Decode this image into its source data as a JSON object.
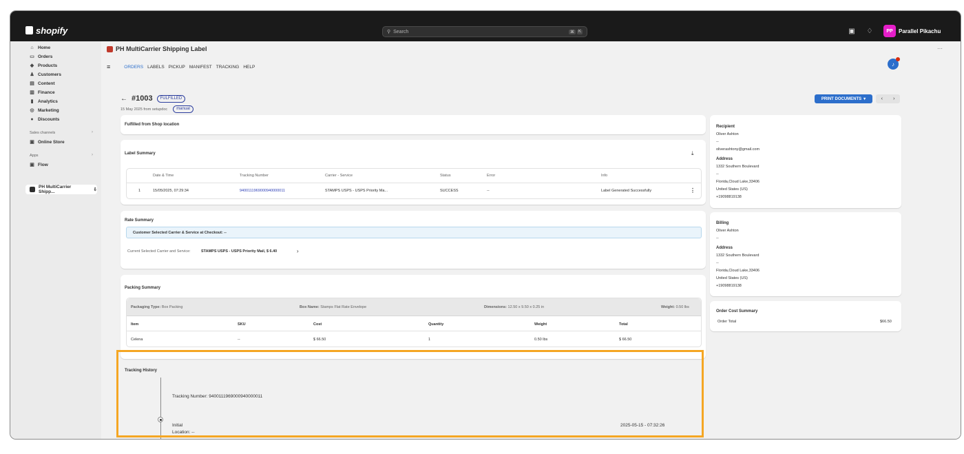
{
  "topbar": {
    "brand": "shopify",
    "search_placeholder": "Search",
    "search_kbd": [
      "⌘",
      "K"
    ],
    "avatar_initials": "PP",
    "user_name": "Parallel Pikachu"
  },
  "sidebar": {
    "items": [
      {
        "label": "Home",
        "icon": "home-icon"
      },
      {
        "label": "Orders",
        "icon": "inbox-icon"
      },
      {
        "label": "Products",
        "icon": "tag-icon"
      },
      {
        "label": "Customers",
        "icon": "person-icon"
      },
      {
        "label": "Content",
        "icon": "image-icon"
      },
      {
        "label": "Finance",
        "icon": "bank-icon"
      },
      {
        "label": "Analytics",
        "icon": "bar-chart-icon"
      },
      {
        "label": "Marketing",
        "icon": "target-icon"
      },
      {
        "label": "Discounts",
        "icon": "discount-icon"
      }
    ],
    "sales_channels_label": "Sales channels",
    "online_store_label": "Online Store",
    "apps_label": "Apps",
    "flow_label": "Flow",
    "active_app_label": "PH MultiCarrier Shipp..."
  },
  "app": {
    "title": "PH MultiCarrier Shipping Label",
    "nav_tabs": [
      "ORDERS",
      "LABELS",
      "PICKUP",
      "MANIFEST",
      "TRACKING",
      "HELP"
    ],
    "active_tab": "ORDERS"
  },
  "order": {
    "number": "#1003",
    "status_badge": "FULFILLED",
    "subtitle": "15 May 2025 from setupdoc",
    "tag": "manual",
    "print_label": "PRINT DOCUMENTS"
  },
  "fulfilled_card": {
    "text": "Fulfilled from Shop location"
  },
  "label_summary": {
    "title": "Label Summary",
    "columns": [
      "",
      "Date & Time",
      "Tracking Number",
      "Carrier - Service",
      "Status",
      "Error",
      "Info"
    ],
    "row": {
      "index": "1",
      "datetime": "15/05/2025, 07:29:34",
      "tracking": "9400111969000940000011",
      "carrier": "STAMPS USPS - USPS Priority Ma...",
      "status": "SUCCESS",
      "error": "--",
      "info": "Label Generated Successfully"
    }
  },
  "rate_summary": {
    "title": "Rate Summary",
    "customer_selected": "Customer Selected Carrier & Service at Checkout: --",
    "current_prefix": "Current Selected Carrier and Service:",
    "current_value": "STAMPS USPS - USPS Priority Mail, $ 6.40"
  },
  "packing_summary": {
    "title": "Packing Summary",
    "packaging_type_label": "Packaging Type:",
    "packaging_type_value": "Box Packing",
    "box_name_label": "Box Name:",
    "box_name_value": "Stamps Flat Rate Envelope",
    "dimensions_label": "Dimensions:",
    "dimensions_value": "12.50 x 9.50 x 0.25 in",
    "weight_label": "Weight:",
    "weight_value": "0.50 lbs",
    "columns": [
      "Item",
      "SKU",
      "Cost",
      "Quantity",
      "Weight",
      "Total"
    ],
    "row": [
      "Celena",
      "--",
      "$ 66.50",
      "1",
      "0.50 lbs",
      "$ 66.50"
    ]
  },
  "tracking_history": {
    "title": "Tracking History",
    "tracking_number": "Tracking Number: 9400111969000940000011",
    "event_status": "Initial",
    "event_location": "Location: --",
    "event_time": "2025-05-15 - 07:32:26"
  },
  "recipient": {
    "title": "Recipient",
    "name": "Oliver Ashton",
    "dash1": "--",
    "email": "oliverashtony@gmail.com",
    "address_label": "Address",
    "line1": "1332 Southern Boulevard",
    "dash2": "--",
    "city": "Florida,Cloud Lake,33406",
    "country": "United States (US)",
    "phone": "+19098819138"
  },
  "billing": {
    "title": "Billing",
    "name": "Oliver Ashton",
    "dash1": "--",
    "address_label": "Address",
    "line1": "1332 Southern Boulevard",
    "dash2": "--",
    "city": "Florida,Cloud Lake,33406",
    "country": "United States (US)",
    "phone": "+19098819138"
  },
  "order_cost": {
    "title": "Order Cost Summary",
    "total_label": "Order Total",
    "total_value": "$66.50"
  },
  "colors": {
    "accent": "#2c6ecb",
    "highlight": "#f5a623",
    "topbar": "#1a1a1a"
  }
}
